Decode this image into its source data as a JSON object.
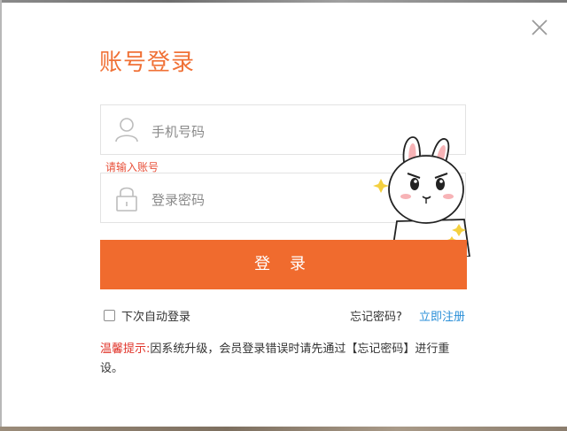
{
  "title": "账号登录",
  "phone_field": {
    "placeholder": "手机号码",
    "icon": "user-icon"
  },
  "error_text": "请输入账号",
  "password_field": {
    "placeholder": "登录密码",
    "icon": "lock-icon"
  },
  "login_button": "登 录",
  "remember_label": "下次自动登录",
  "forgot_link": "忘记密码?",
  "register_link": "立即注册",
  "notice": {
    "label": "温馨提示:",
    "text": "因系统升级，会员登录错误时请先通过【忘记密码】进行重设。"
  },
  "colors": {
    "accent": "#f06b2e",
    "title": "#f07136",
    "link": "#2a8fd8",
    "warning": "#e0352b"
  }
}
